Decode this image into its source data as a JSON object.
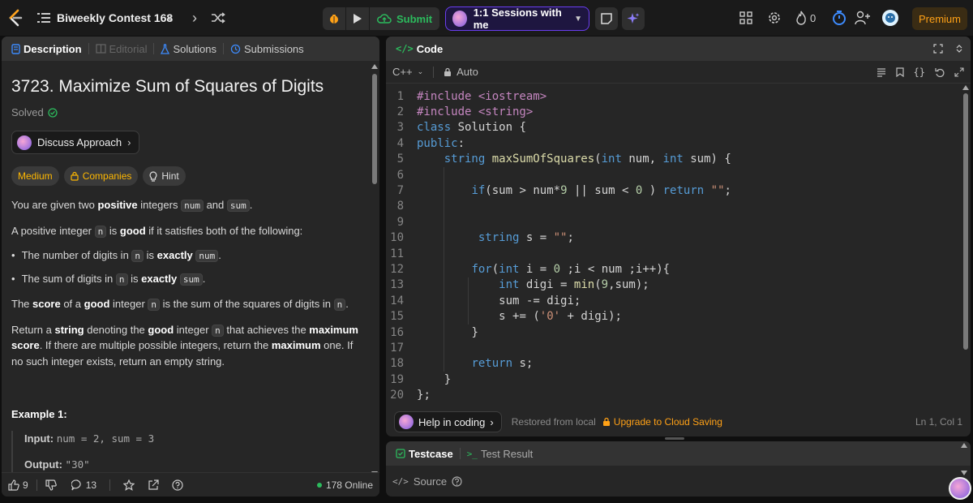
{
  "topbar": {
    "contest_title": "Biweekly Contest 168",
    "submit_label": "Submit",
    "sessions_label": "1:1 Sessions with me",
    "streak_count": "0",
    "premium_label": "Premium"
  },
  "left": {
    "tabs": [
      "Description",
      "Editorial",
      "Solutions",
      "Submissions"
    ],
    "problem_title": "3723. Maximize Sum of Squares of Digits",
    "solved_label": "Solved",
    "discuss_label": "Discuss Approach",
    "tags": {
      "difficulty": "Medium",
      "companies": "Companies",
      "hint": "Hint"
    },
    "p1": {
      "a": "You are given two ",
      "b": "positive",
      "c": " integers ",
      "code1": "num",
      "d": " and ",
      "code2": "sum",
      "e": "."
    },
    "p2": {
      "a": "A positive integer ",
      "code": "n",
      "b": " is ",
      "c": "good",
      "d": " if it satisfies both of the following:"
    },
    "b1": {
      "a": "The number of digits in ",
      "code": "n",
      "b": " is ",
      "c": "exactly",
      "code2": "num",
      "d": "."
    },
    "b2": {
      "a": "The sum of digits in ",
      "code": "n",
      "b": " is ",
      "c": "exactly",
      "code2": "sum",
      "d": "."
    },
    "p3": {
      "a": "The ",
      "b": "score",
      "c": " of a ",
      "d": "good",
      "e": " integer ",
      "code": "n",
      "f": " is the sum of the squares of digits in ",
      "code2": "n",
      "g": "."
    },
    "p4": {
      "a": "Return a ",
      "b": "string",
      "c": " denoting the ",
      "d": "good",
      "e": " integer ",
      "code": "n",
      "f": " that achieves the ",
      "g": "maximum",
      "h": "score",
      "i": ". If there are multiple possible integers, return the ",
      "j": "maximum",
      "k": " one. If no such integer exists, return an empty string."
    },
    "example_title": "Example 1:",
    "input_label": "Input:",
    "input_value": "num = 2, sum = 3",
    "output_label": "Output:",
    "output_value": "\"30\"",
    "footer": {
      "likes": "9",
      "comments": "13",
      "online": "178 Online"
    }
  },
  "editor": {
    "title": "Code",
    "language": "C++",
    "mode": "Auto",
    "lines": [
      "#include <iostream>",
      "#include <string>",
      "class Solution {",
      "public:",
      "    string maxSumOfSquares(int num, int sum) {",
      "",
      "        if(sum > num*9 || sum < 0 ) return \"\";",
      "",
      "",
      "         string s = \"\";",
      "",
      "        for(int i = 0 ;i < num ;i++){",
      "            int digi = min(9,sum);",
      "            sum -= digi;",
      "            s += ('0' + digi);",
      "        }",
      "",
      "        return s;",
      "    }",
      "};"
    ],
    "help_label": "Help in coding",
    "restored_label": "Restored from local",
    "upgrade_label": "Upgrade to Cloud Saving",
    "cursor_pos": "Ln 1, Col 1"
  },
  "bottom": {
    "testcase_label": "Testcase",
    "result_label": "Test Result",
    "source_label": "Source"
  },
  "colors": {
    "accent_green": "#2cbb5d",
    "premium": "#ffa116",
    "medium": "#ffb800",
    "purple": "#6a3ef0"
  }
}
